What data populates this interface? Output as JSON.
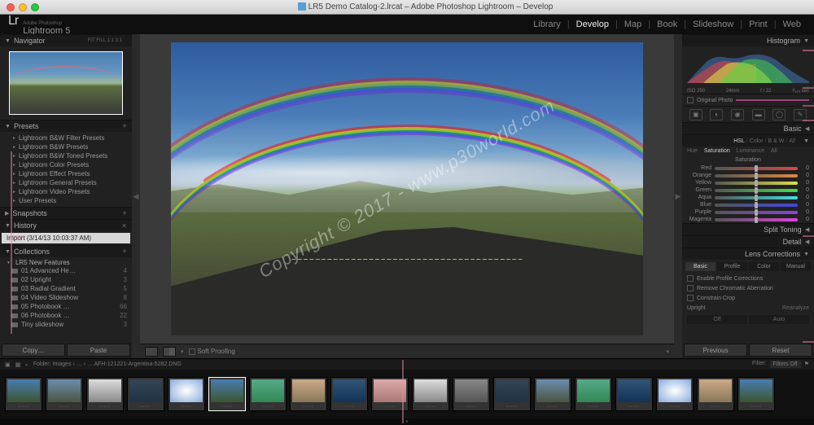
{
  "window": {
    "title": "LR5 Demo Catalog-2.lrcat – Adobe Photoshop Lightroom – Develop"
  },
  "brand": {
    "logo": "Lr",
    "line1": "Adobe Photoshop",
    "line2": "Lightroom 5"
  },
  "modules": [
    "Library",
    "Develop",
    "Map",
    "Book",
    "Slideshow",
    "Print",
    "Web"
  ],
  "active_module": "Develop",
  "navigator": {
    "title": "Navigator",
    "opts": "FIT  FILL  1:1  3:1"
  },
  "presets": {
    "title": "Presets",
    "items": [
      "Lightroom B&W Filter Presets",
      "Lightroom B&W Presets",
      "Lightroom B&W Toned Presets",
      "Lightroom Color Presets",
      "Lightroom Effect Presets",
      "Lightroom General Presets",
      "Lightroom Video Presets",
      "User Presets"
    ]
  },
  "snapshots": {
    "title": "Snapshots"
  },
  "history": {
    "title": "History",
    "items": [
      "Import (3/14/13 10:03:37 AM)"
    ]
  },
  "collections": {
    "title": "Collections",
    "parent": "LR5 New Features",
    "items": [
      {
        "name": "01 Advanced He…",
        "count": "4"
      },
      {
        "name": "02 Upright",
        "count": "3"
      },
      {
        "name": "03 Radial Gradient",
        "count": "5"
      },
      {
        "name": "04 Video Slideshow",
        "count": "8"
      },
      {
        "name": "05 Photobook …",
        "count": "66"
      },
      {
        "name": "06 Photobook …",
        "count": "22"
      },
      {
        "name": "Tiny slideshow",
        "count": "3"
      }
    ]
  },
  "left_buttons": {
    "copy": "Copy…",
    "paste": "Paste"
  },
  "canvas_toolbar": {
    "soft_proofing": "Soft Proofing"
  },
  "watermark": "Copyright © 2017 - www.p30world.com",
  "histogram": {
    "title": "Histogram",
    "info": {
      "iso": "ISO 250",
      "focal": "24mm",
      "aperture": "f / 22",
      "shutter": "¹⁄₁₂₅ sec"
    },
    "original": "Original Photo"
  },
  "basic": {
    "title": "Basic"
  },
  "hsl": {
    "title_tabs": [
      "HSL",
      "Color",
      "B & W",
      "All"
    ],
    "sub_tabs": [
      "Hue",
      "Saturation",
      "Luminance",
      "All"
    ],
    "section": "Saturation",
    "sliders": [
      {
        "label": "Red",
        "cls": "tr-red",
        "val": "0"
      },
      {
        "label": "Orange",
        "cls": "tr-orange",
        "val": "0"
      },
      {
        "label": "Yellow",
        "cls": "tr-yellow",
        "val": "0"
      },
      {
        "label": "Green",
        "cls": "tr-green",
        "val": "0"
      },
      {
        "label": "Aqua",
        "cls": "tr-aqua",
        "val": "0"
      },
      {
        "label": "Blue",
        "cls": "tr-blue",
        "val": "0"
      },
      {
        "label": "Purple",
        "cls": "tr-purple",
        "val": "0"
      },
      {
        "label": "Magenta",
        "cls": "tr-magenta",
        "val": "0"
      }
    ]
  },
  "split_toning": {
    "title": "Split Toning"
  },
  "detail": {
    "title": "Detail"
  },
  "lens": {
    "title": "Lens Corrections",
    "tabs": [
      "Basic",
      "Profile",
      "Color",
      "Manual"
    ],
    "checks": [
      "Enable Profile Corrections",
      "Remove Chromatic Aberration",
      "Constrain Crop"
    ],
    "upright": "Upright",
    "reanalyze": "Reanalyze",
    "off": "Off",
    "auto": "Auto"
  },
  "right_buttons": {
    "previous": "Previous",
    "reset": "Reset"
  },
  "filmstrip": {
    "breadcrumb": "Folder: Images  › … › …  AFH-121221-Argentina-5282.DNG",
    "filter": "Filter:",
    "filters_off": "Filters Off",
    "count": 19
  }
}
